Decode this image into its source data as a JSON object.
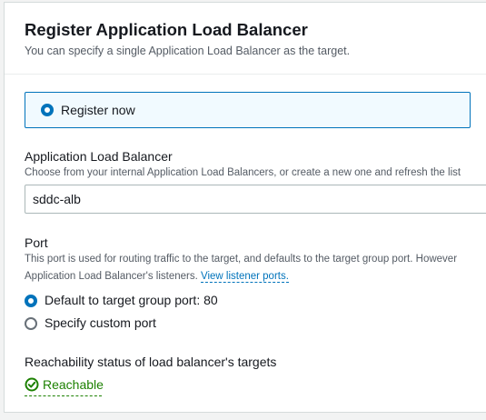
{
  "panel": {
    "title": "Register Application Load Balancer",
    "subtitle": "You can specify a single Application Load Balancer as the target."
  },
  "register_option": {
    "label": "Register now",
    "selected": true
  },
  "alb_field": {
    "label": "Application Load Balancer",
    "description": "Choose from your internal Application Load Balancers, or create a new one and refresh the list",
    "value": "sddc-alb"
  },
  "port_field": {
    "label": "Port",
    "description_line1": "This port is used for routing traffic to the target, and defaults to the target group port. However",
    "description_line2": "Application Load Balancer's listeners.",
    "link_text": "View listener ports.",
    "options": [
      {
        "label": "Default to target group port: 80",
        "selected": true
      },
      {
        "label": "Specify custom port",
        "selected": false
      }
    ]
  },
  "reachability": {
    "label": "Reachability status of load balancer's targets",
    "status": "Reachable",
    "status_color": "#1d8102",
    "icon": "check-circle-icon"
  },
  "colors": {
    "accent": "#0073bb",
    "success": "#1d8102"
  }
}
